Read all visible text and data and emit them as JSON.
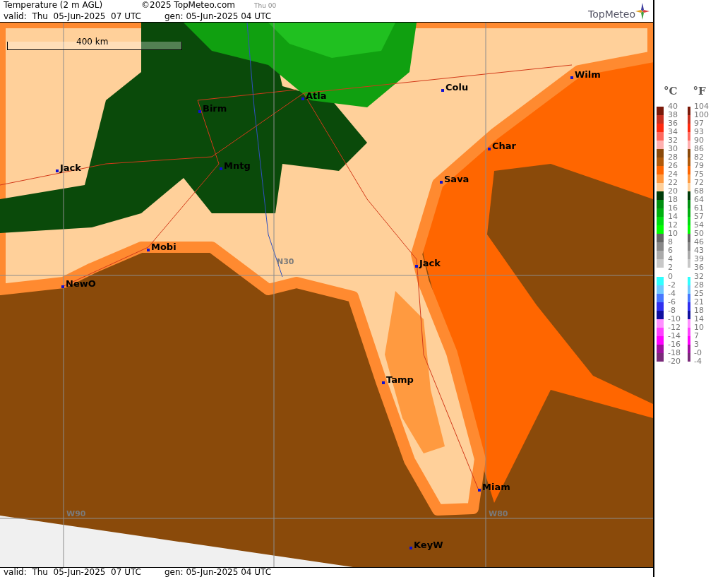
{
  "header": {
    "title": "Temperature (2 m AGL)",
    "copyright": "©2025 TopMeteo.com",
    "run_label": "Thu 00",
    "valid": "valid:  Thu  05-Jun-2025  07 UTC",
    "generated": "gen: 05-Jun-2025 04 UTC",
    "logo": "TopMeteo"
  },
  "map": {
    "scale": "400 km",
    "grid_labels": [
      "N30",
      "W90",
      "W80"
    ],
    "cities": [
      "Atla",
      "Birm",
      "Mntg",
      "Jack",
      "Mobi",
      "NewO",
      "Colu",
      "Wilm",
      "Char",
      "Sava",
      "Jack",
      "Tamp",
      "Miam",
      "KeyW"
    ]
  },
  "footer": {
    "valid": "valid:  Thu  05-Jun-2025  07 UTC",
    "generated": "gen: 05-Jun-2025 04 UTC"
  },
  "legend": {
    "celsius_unit": "°C",
    "fahrenheit_unit": "°F",
    "celsius_ticks": [
      "40",
      "38",
      "36",
      "34",
      "32",
      "30",
      "28",
      "26",
      "24",
      "22",
      "20",
      "18",
      "16",
      "14",
      "12",
      "10",
      "8",
      "6",
      "4",
      "2",
      "0",
      "-2",
      "-4",
      "-6",
      "-8",
      "-10",
      "-12",
      "-14",
      "-16",
      "-18",
      "-20"
    ],
    "fahrenheit_ticks": [
      "104",
      "100",
      "97",
      "93",
      "90",
      "86",
      "82",
      "79",
      "75",
      "72",
      "68",
      "64",
      "61",
      "57",
      "54",
      "50",
      "46",
      "43",
      "39",
      "36",
      "32",
      "28",
      "25",
      "21",
      "18",
      "14",
      "10",
      "7",
      "3",
      "-0",
      "-4"
    ],
    "warm_bands": [
      {
        "color": "#7a1a0a"
      },
      {
        "color": "#c83020"
      },
      {
        "color": "#ff2a10"
      },
      {
        "color": "#ff6a60"
      },
      {
        "color": "#ffb0b0"
      },
      {
        "color": "#8a4a0a"
      },
      {
        "color": "#b05a0a"
      },
      {
        "color": "#ff6600"
      },
      {
        "color": "#ff9a40"
      },
      {
        "color": "#ffd09a"
      },
      {
        "color": "#003c0a"
      },
      {
        "color": "#009010"
      },
      {
        "color": "#00b010"
      },
      {
        "color": "#00dd10"
      },
      {
        "color": "#00ff00"
      },
      {
        "color": "#666666"
      },
      {
        "color": "#888888"
      },
      {
        "color": "#aaaaaa"
      },
      {
        "color": "#c8c8c8"
      }
    ],
    "cold_bands": [
      {
        "color": "#30ffff"
      },
      {
        "color": "#70c8ff"
      },
      {
        "color": "#4878ff"
      },
      {
        "color": "#3030f0"
      },
      {
        "color": "#1010a0"
      },
      {
        "color": "#ff90ff"
      },
      {
        "color": "#ff40ff"
      },
      {
        "color": "#ff00ff"
      },
      {
        "color": "#a010a0"
      },
      {
        "color": "#7a2a7a"
      }
    ]
  }
}
